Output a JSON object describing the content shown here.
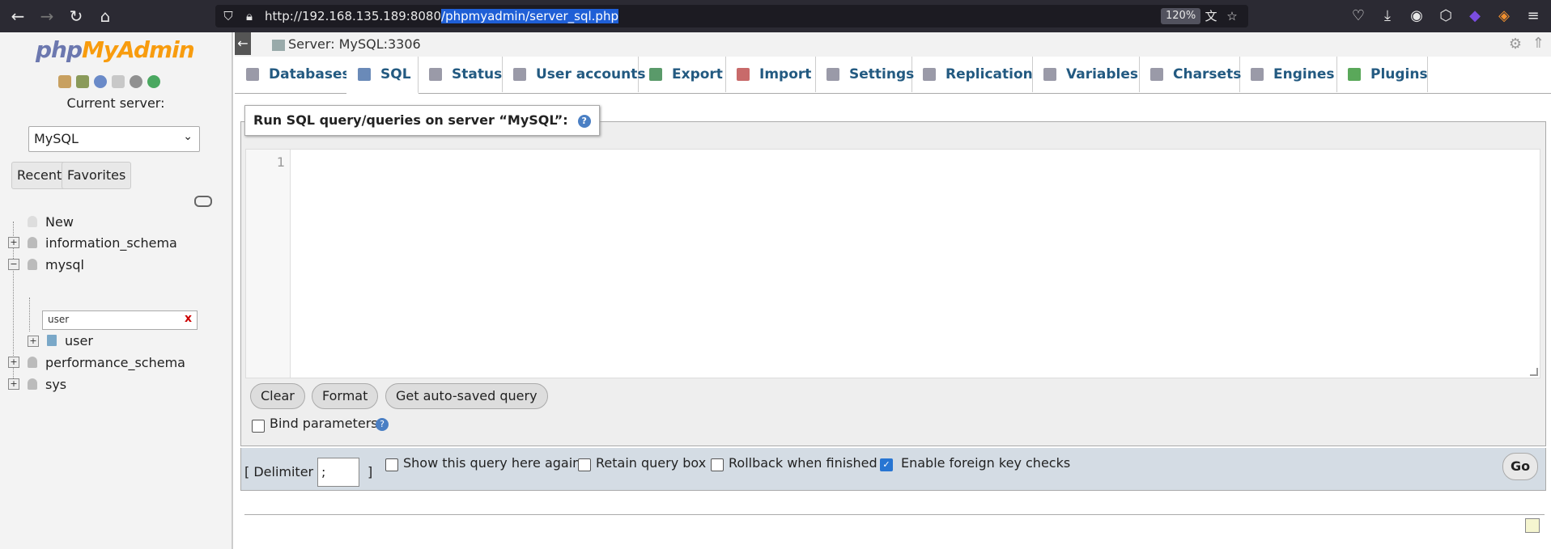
{
  "browser": {
    "url_prefix": "http://192.168.135.189:8080",
    "url_selected": "/phpmyadmin/server_sql.php",
    "zoom": "120%"
  },
  "sidebar": {
    "logo_a": "php",
    "logo_b": "MyAdmin",
    "current_server_label": "Current server:",
    "server_value": "MySQL",
    "tab_recent": "Recent",
    "tab_favorites": "Favorites",
    "tree": {
      "new": "New",
      "information_schema": "information_schema",
      "mysql": "mysql",
      "filter_value": "user",
      "filter_clear": "x",
      "user": "user",
      "performance_schema": "performance_schema",
      "sys": "sys"
    }
  },
  "topbar": {
    "server_label": "Server: MySQL:3306"
  },
  "tabs": [
    {
      "label": "Databases"
    },
    {
      "label": "SQL"
    },
    {
      "label": "Status"
    },
    {
      "label": "User accounts"
    },
    {
      "label": "Export"
    },
    {
      "label": "Import"
    },
    {
      "label": "Settings"
    },
    {
      "label": "Replication"
    },
    {
      "label": "Variables"
    },
    {
      "label": "Charsets"
    },
    {
      "label": "Engines"
    },
    {
      "label": "Plugins"
    }
  ],
  "sql": {
    "legend": "Run SQL query/queries on server “MySQL”:",
    "line_number": "1",
    "btn_clear": "Clear",
    "btn_format": "Format",
    "btn_autosaved": "Get auto-saved query",
    "bind_params": "Bind parameters",
    "delimiter_open": "[ Delimiter",
    "delimiter_value": ";",
    "delimiter_close": "]",
    "show_query_again": "Show this query here again",
    "retain_box": "Retain query box",
    "rollback": "Rollback when finished",
    "foreign_keys": "Enable foreign key checks",
    "go": "Go"
  }
}
